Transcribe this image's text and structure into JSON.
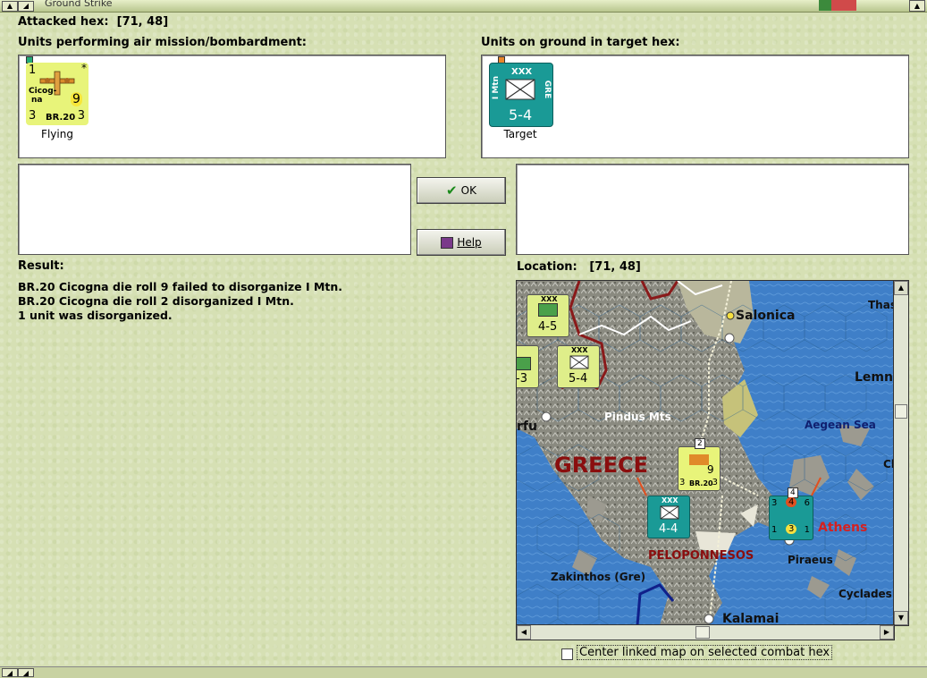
{
  "window": {
    "title": "Ground Strike"
  },
  "attacked_hex": {
    "label": "Attacked hex:",
    "value": "[71, 48]"
  },
  "air_units": {
    "header": "Units performing air mission/bombardment:",
    "items": [
      {
        "top_left": "1",
        "top_right": "*",
        "name_line1": "Cicog-",
        "name_line2": "na",
        "attack": "9",
        "bottom_left": "3",
        "type": "BR.20",
        "bottom_right": "3",
        "status": "Flying",
        "color": "#e8f47a"
      }
    ]
  },
  "ground_units": {
    "header": "Units on ground in target hex:",
    "items": [
      {
        "size": "XXX",
        "name": "I Mtn",
        "nation": "GRE",
        "strength": "5-4",
        "status": "Target",
        "color": "#1a9a96"
      }
    ]
  },
  "buttons": {
    "ok": "OK",
    "help": "Help"
  },
  "result": {
    "label": "Result:",
    "lines": [
      "BR.20 Cicogna die roll 9 failed to disorganize I Mtn.",
      "BR.20 Cicogna die roll 2 disorganized I Mtn.",
      "1 unit was disorganized."
    ]
  },
  "location": {
    "label": "Location:",
    "value": "[71, 48]"
  },
  "map": {
    "labels": {
      "salonica": "Salonica",
      "thas": "Thas",
      "lemn": "Lemn",
      "pindus": "Pindus Mts",
      "aegean": "Aegean Sea",
      "greece": "GREECE",
      "corfu": "rfu",
      "cl": "Cl",
      "athens": "Athens",
      "peloponnesos": "PELOPONNESOS",
      "piraeus": "Piraeus",
      "zakinthos": "Zakinthos (Gre)",
      "cyclades": "Cyclades",
      "kalamai": "Kalamai"
    },
    "counters": {
      "c1_str": "4-5",
      "c2_str": "-3",
      "c3_str": "5-4",
      "c4_str": "4-4",
      "c4_size": "XXX",
      "c1_size": "XXX",
      "c3_size": "XXX",
      "stack_badge": "2",
      "stack_badge2": "4",
      "br20_attack": "9",
      "br20_bl": "3",
      "br20_type": "BR.20",
      "br20_br": "3",
      "ath_top_left": "3",
      "ath_mid": "4",
      "ath_top_right": "6",
      "ath_bl": "1",
      "ath_center": "3",
      "ath_br": "1"
    }
  },
  "center_checkbox": {
    "label": "Center linked map on selected combat hex",
    "checked": false
  }
}
